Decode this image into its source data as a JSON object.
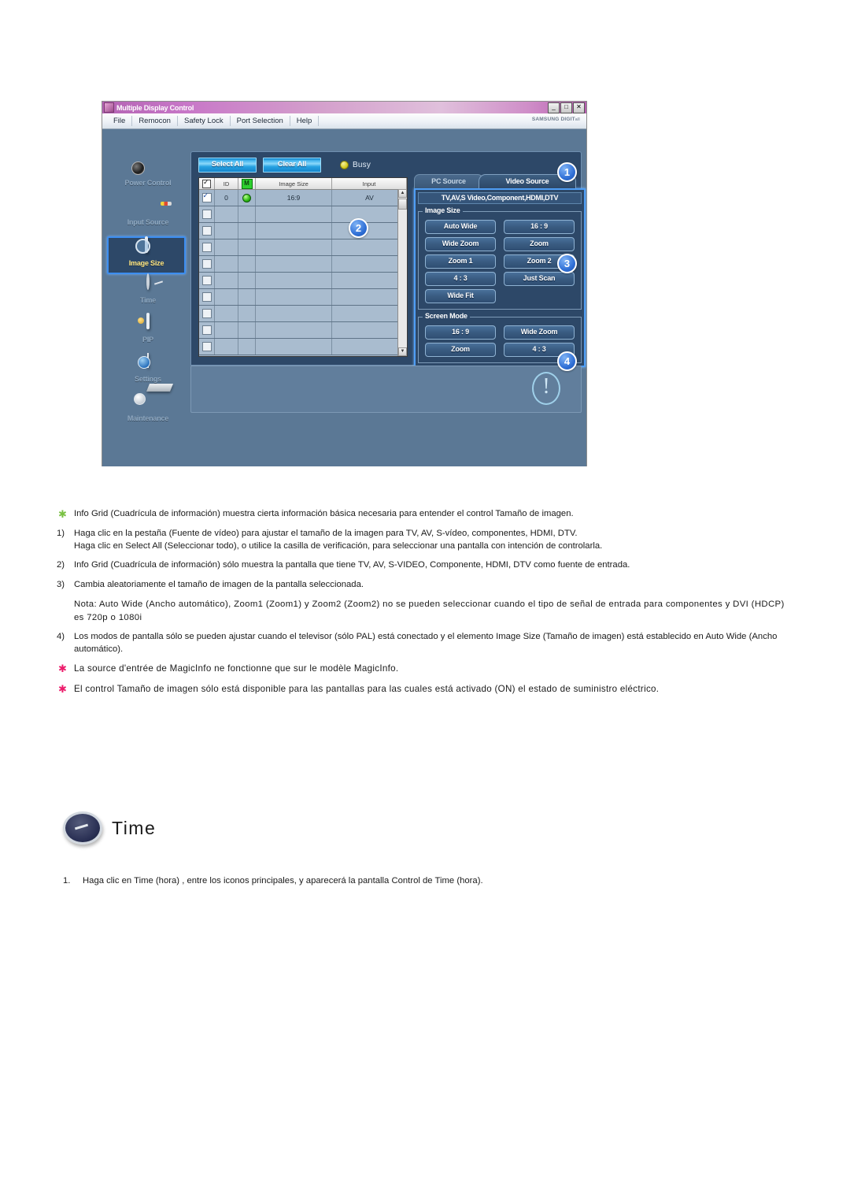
{
  "app": {
    "title": "Multiple Display Control",
    "window_buttons": [
      "_",
      "□",
      "✕"
    ],
    "brand": "SAMSUNG DIGIT",
    "brand_sub": "all",
    "menu": [
      "File",
      "Remocon",
      "Safety Lock",
      "Port Selection",
      "Help"
    ],
    "sidebar": [
      {
        "label": "Power Control",
        "icon": "camera-icon",
        "active": false
      },
      {
        "label": "Input Source",
        "icon": "input-box-icon",
        "active": false
      },
      {
        "label": "Image Size",
        "icon": "screen-icon",
        "active": true
      },
      {
        "label": "Time",
        "icon": "clock-icon",
        "active": false
      },
      {
        "label": "PIP",
        "icon": "pip-screen-icon",
        "active": false
      },
      {
        "label": "Settings",
        "icon": "cube-settings-icon",
        "active": false
      },
      {
        "label": "Maintenance",
        "icon": "tools-icon",
        "active": false
      }
    ],
    "toolbar": {
      "select_all": "Select All",
      "clear_all": "Clear All",
      "busy_label": "Busy"
    },
    "grid": {
      "columns": [
        "",
        "ID",
        "M",
        "Image Size",
        "Input"
      ],
      "rows": [
        {
          "checked": true,
          "id": "0",
          "power": true,
          "image_size": "16:9",
          "input": "AV"
        },
        {
          "checked": false,
          "id": "",
          "power": false,
          "image_size": "",
          "input": ""
        },
        {
          "checked": false,
          "id": "",
          "power": false,
          "image_size": "",
          "input": ""
        },
        {
          "checked": false,
          "id": "",
          "power": false,
          "image_size": "",
          "input": ""
        },
        {
          "checked": false,
          "id": "",
          "power": false,
          "image_size": "",
          "input": ""
        },
        {
          "checked": false,
          "id": "",
          "power": false,
          "image_size": "",
          "input": ""
        },
        {
          "checked": false,
          "id": "",
          "power": false,
          "image_size": "",
          "input": ""
        },
        {
          "checked": false,
          "id": "",
          "power": false,
          "image_size": "",
          "input": ""
        },
        {
          "checked": false,
          "id": "",
          "power": false,
          "image_size": "",
          "input": ""
        },
        {
          "checked": false,
          "id": "",
          "power": false,
          "image_size": "",
          "input": ""
        }
      ],
      "scroll_up": "▲",
      "scroll_down": "▼"
    },
    "tabs": [
      {
        "label": "PC Source",
        "active": false
      },
      {
        "label": "Video Source",
        "active": true
      }
    ],
    "source_label": "TV,AV,S Video,Component,HDMI,DTV",
    "image_size_group": {
      "title": "Image Size",
      "buttons": [
        "Auto Wide",
        "16 : 9",
        "Wide Zoom",
        "Zoom",
        "Zoom 1",
        "Zoom 2",
        "4 : 3",
        "Just Scan",
        "Wide Fit"
      ]
    },
    "screen_mode_group": {
      "title": "Screen Mode",
      "buttons": [
        "16 : 9",
        "Wide Zoom",
        "Zoom",
        "4 : 3"
      ]
    },
    "badges": [
      "1",
      "2",
      "3",
      "4"
    ],
    "colors": {
      "window_bg": "#5b7895",
      "panel_bg": "#2d4868",
      "accent_button": "#29a8e8",
      "highlight_border": "#4f9ef5",
      "active_label": "#ffe680",
      "titlebar_start": "#b464b4",
      "titlebar_end": "#e0c0dc"
    }
  },
  "doc": {
    "items": [
      {
        "marker": "star-green",
        "text": "Info Grid (Cuadrícula de información) muestra cierta información básica necesaria para entender el control Tamaño de imagen."
      },
      {
        "marker": "1)",
        "text": "Haga clic en la pestaña (Fuente de vídeo) para ajustar el tamaño de la imagen para TV, AV, S-vídeo, componentes, HDMI, DTV.",
        "text2": "Haga clic en Select All (Seleccionar todo), o utilice la casilla de verificación, para seleccionar una pantalla con intención de controlarla."
      },
      {
        "marker": "2)",
        "text": "Info Grid (Cuadrícula de información) sólo muestra la pantalla que tiene TV, AV, S-VIDEO, Componente, HDMI, DTV como fuente de entrada."
      },
      {
        "marker": "3)",
        "text": "Cambia aleatoriamente el tamaño de imagen de la pantalla seleccionada."
      },
      {
        "marker": "note",
        "text": "Nota: Auto Wide (Ancho automático), Zoom1 (Zoom1) y Zoom2 (Zoom2) no se pueden seleccionar cuando el tipo de señal de entrada para componentes y DVI (HDCP) es 720p o 1080i"
      },
      {
        "marker": "4)",
        "text": "Los modos de pantalla sólo se pueden ajustar cuando el televisor (sólo PAL) está conectado y el elemento Image Size (Tamaño de imagen) está establecido en Auto Wide (Ancho automático)."
      },
      {
        "marker": "star-pink",
        "text": "La source d'entrée de MagicInfo ne fonctionne que sur le modèle MagicInfo."
      },
      {
        "marker": "star-pink",
        "text": "El control Tamaño de imagen sólo está disponible para las pantallas para las cuales está activado (ON) el estado de suministro eléctrico."
      }
    ]
  },
  "time_section": {
    "title": "Time",
    "step_num": "1.",
    "step_text": "Haga clic en Time (hora) , entre los iconos principales, y aparecerá la pantalla Control de Time (hora)."
  }
}
